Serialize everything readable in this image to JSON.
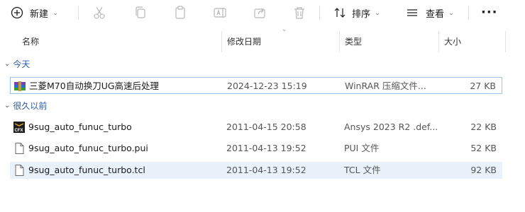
{
  "toolbar": {
    "new_label": "新建",
    "sort_label": "排序",
    "view_label": "查看"
  },
  "columns": {
    "name": "名称",
    "date": "修改日期",
    "type": "类型",
    "size": "大小"
  },
  "groups": {
    "today": "今天",
    "long_ago": "很久以前"
  },
  "files": [
    {
      "name": "三菱M70自动换刀UG高速后处理",
      "date": "2024-12-23 15:19",
      "type": "WinRAR 压缩文件...",
      "size": "27 KB",
      "icon": "winrar-archive-icon"
    },
    {
      "name": "9sug_auto_funuc_turbo",
      "date": "2011-04-15 20:58",
      "type": "Ansys 2023 R2 .def...",
      "size": "22 KB",
      "icon": "cfx-def-file-icon"
    },
    {
      "name": "9sug_auto_funuc_turbo.pui",
      "date": "2011-04-13 19:52",
      "type": "PUI 文件",
      "size": "52 KB",
      "icon": "document-icon"
    },
    {
      "name": "9sug_auto_funuc_turbo.tcl",
      "date": "2011-04-13 19:52",
      "type": "TCL 文件",
      "size": "92 KB",
      "icon": "document-icon"
    }
  ]
}
